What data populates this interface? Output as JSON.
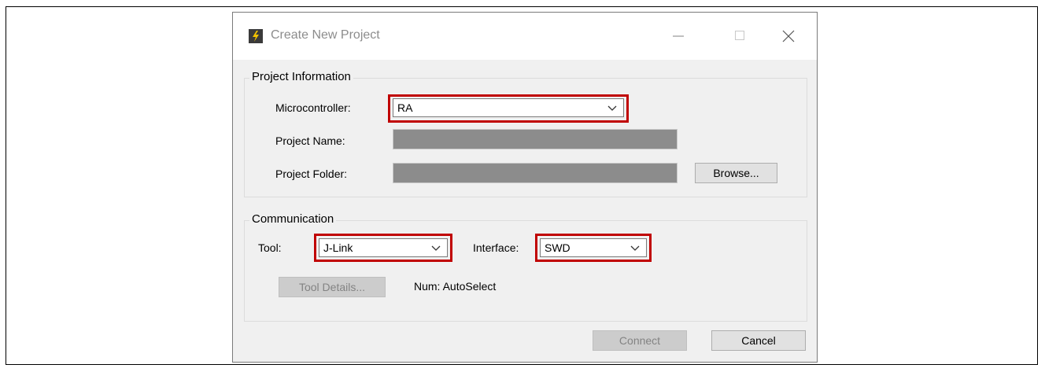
{
  "window": {
    "title": "Create New Project"
  },
  "project_info": {
    "legend": "Project Information",
    "microcontroller_label": "Microcontroller:",
    "microcontroller_value": "RA",
    "project_name_label": "Project Name:",
    "project_folder_label": "Project Folder:",
    "browse_label": "Browse..."
  },
  "communication": {
    "legend": "Communication",
    "tool_label": "Tool:",
    "tool_value": "J-Link",
    "interface_label": "Interface:",
    "interface_value": "SWD",
    "tool_details_label": "Tool Details...",
    "num_text": "Num: AutoSelect"
  },
  "footer": {
    "connect_label": "Connect",
    "cancel_label": "Cancel"
  },
  "colors": {
    "highlight": "#c00000",
    "dialog_bg": "#f0f0f0"
  },
  "icons": [
    "app-icon",
    "minimize-icon",
    "maximize-icon",
    "close-icon",
    "chevron-down-icon"
  ]
}
